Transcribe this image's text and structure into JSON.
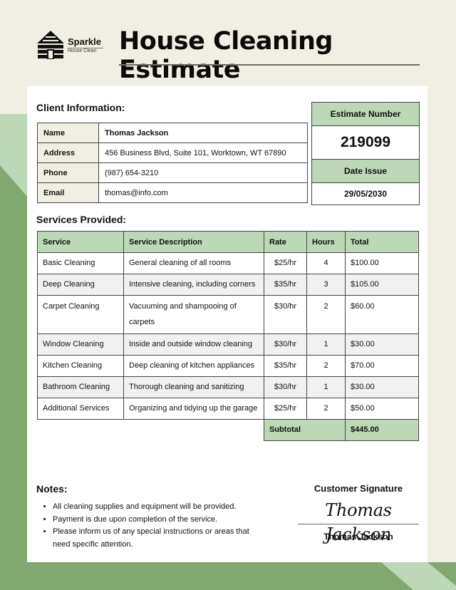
{
  "logo": {
    "brand": "Sparkle",
    "subtitle": "House Clean",
    "icon": "log-cabin-icon"
  },
  "title": "House Cleaning Estimate",
  "colors": {
    "accent_green": "#bcd8b6",
    "dark_green": "#81a86f",
    "light_green": "#bcd8b6",
    "cream": "#f1efe3"
  },
  "client": {
    "heading": "Client Information:",
    "rows": [
      {
        "label": "Name",
        "value": "Thomas Jackson"
      },
      {
        "label": "Address",
        "value": "456 Business Blvd, Suite 101, Worktown, WT 67890"
      },
      {
        "label": "Phone",
        "value": "(987) 654-3210"
      },
      {
        "label": "Email",
        "value": "thomas@info.com"
      }
    ]
  },
  "estimate": {
    "number_label": "Estimate Number",
    "number": "219099",
    "date_label": "Date Issue",
    "date": "29/05/2030"
  },
  "services": {
    "heading": "Services Provided:",
    "columns": [
      "Service",
      "Service Description",
      "Rate",
      "Hours",
      "Total"
    ],
    "rows": [
      {
        "service": "Basic Cleaning",
        "description": "General cleaning of all rooms",
        "rate": "$25/hr",
        "hours": "4",
        "total": "$100.00"
      },
      {
        "service": "Deep Cleaning",
        "description": "Intensive cleaning, including corners",
        "rate": "$35/hr",
        "hours": "3",
        "total": "$105.00"
      },
      {
        "service": "Carpet Cleaning",
        "description": "Vacuuming and shampooing of carpets",
        "rate": "$30/hr",
        "hours": "2",
        "total": "$60.00"
      },
      {
        "service": "Window Cleaning",
        "description": "Inside and outside window cleaning",
        "rate": "$30/hr",
        "hours": "1",
        "total": "$30.00"
      },
      {
        "service": "Kitchen Cleaning",
        "description": "Deep cleaning of kitchen appliances",
        "rate": "$35/hr",
        "hours": "2",
        "total": "$70.00"
      },
      {
        "service": "Bathroom Cleaning",
        "description": "Thorough cleaning and sanitizing",
        "rate": "$30/hr",
        "hours": "1",
        "total": "$30.00"
      },
      {
        "service": "Additional Services",
        "description": "Organizing and tidying up the garage",
        "rate": "$25/hr",
        "hours": "2",
        "total": "$50.00"
      }
    ],
    "subtotal_label": "Subtotal",
    "subtotal": "$445.00"
  },
  "notes": {
    "heading": "Notes:",
    "items": [
      "All cleaning supplies and equipment will be provided.",
      "Payment is due upon completion of the service.",
      "Please inform us of any special instructions or areas that need specific attention."
    ]
  },
  "signature": {
    "label": "Customer Signature",
    "script": "Thomas Jackson",
    "name": "Thomas Jackson"
  }
}
